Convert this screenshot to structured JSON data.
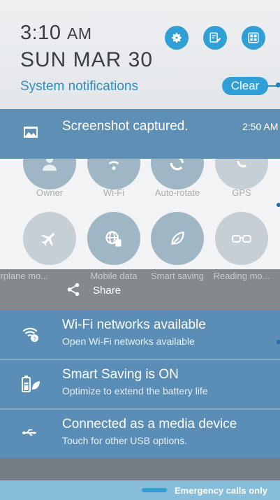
{
  "header": {
    "time": "3:10",
    "ampm": "AM",
    "date": "SUN MAR 30",
    "system_notifications": "System notifications",
    "clear_label": "Clear",
    "accent_color": "#2f9fd6"
  },
  "screenshot_notification": {
    "title": "Screenshot captured.",
    "time": "2:50 AM"
  },
  "quick_settings": {
    "row1": [
      "Owner",
      "Wi-Fi",
      "Auto-rotate",
      "GPS"
    ],
    "row2": [
      "Airplane mo...",
      "Mobile data",
      "Smart saving",
      "Reading mo..."
    ]
  },
  "share": {
    "label": "Share"
  },
  "notifications": [
    {
      "icon": "wifi-question-icon",
      "title": "Wi-Fi networks available",
      "subtitle": "Open Wi-Fi networks available"
    },
    {
      "icon": "battery-leaf-icon",
      "title": "Smart Saving is ON",
      "subtitle": "Optimize to extend the battery life"
    },
    {
      "icon": "usb-icon",
      "title": "Connected as a media device",
      "subtitle": "Touch for other USB options."
    }
  ],
  "status": {
    "emergency": "Emergency calls only"
  }
}
